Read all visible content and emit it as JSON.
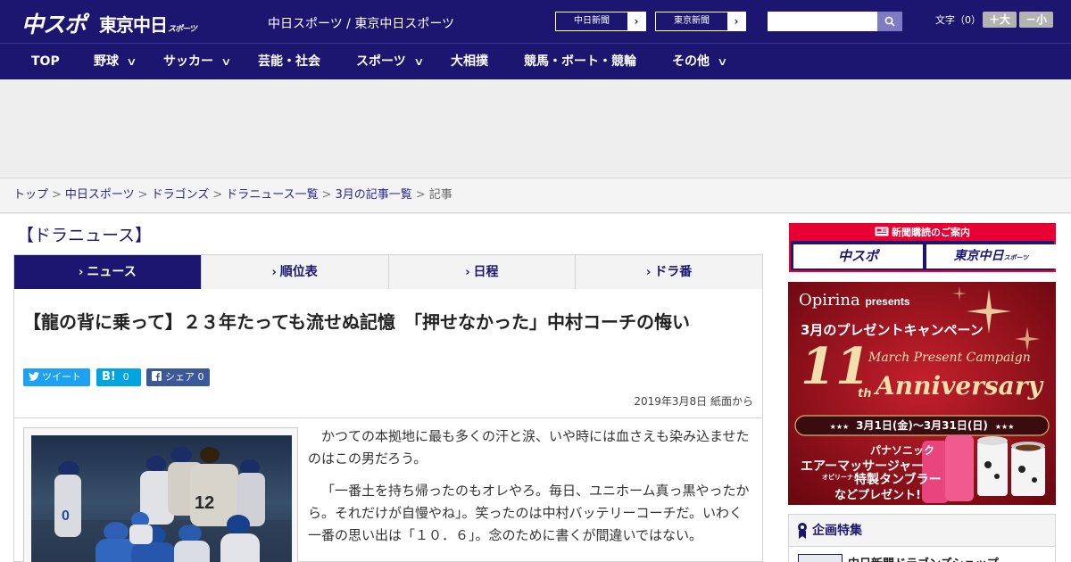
{
  "header": {
    "logo_main": "中スポ",
    "logo_sub": "東京中日",
    "logo_sub_small": "スポーツ",
    "site_title": "中日スポーツ / 東京中日スポーツ",
    "paper_links": [
      {
        "label": "中日新聞",
        "arrow": "›"
      },
      {
        "label": "東京新聞",
        "arrow": "›"
      }
    ],
    "search_placeholder": "",
    "fontsize_label": "文字（0）",
    "fontsize_up": "＋大",
    "fontsize_down": "－小"
  },
  "nav": [
    {
      "label": "TOP",
      "dropdown": false
    },
    {
      "label": "野球",
      "dropdown": true
    },
    {
      "label": "サッカー",
      "dropdown": true
    },
    {
      "label": "芸能・社会",
      "dropdown": false
    },
    {
      "label": "スポーツ",
      "dropdown": true
    },
    {
      "label": "大相撲",
      "dropdown": false
    },
    {
      "label": "競馬・ボート・競輪",
      "dropdown": false
    },
    {
      "label": "その他",
      "dropdown": true
    }
  ],
  "nav_chevron": "∨",
  "breadcrumb": {
    "links": [
      "トップ",
      "中日スポーツ",
      "ドラゴンズ",
      "ドラニュース一覧",
      "3月の記事一覧"
    ],
    "separator": ">",
    "current": "記事"
  },
  "section_title": "【ドラニュース】",
  "tabs": [
    {
      "label": "ニュース",
      "active": true
    },
    {
      "label": "順位表",
      "active": false
    },
    {
      "label": "日程",
      "active": false
    },
    {
      "label": "ドラ番",
      "active": false
    }
  ],
  "tab_chevron": "›",
  "article": {
    "headline": "【龍の背に乗って】２３年たっても流せぬ記憶　「押せなかった」中村コーチの悔い",
    "share": {
      "tweet": "ツイート",
      "hatena": "B!",
      "hatena_count": "0",
      "facebook": "シェア",
      "facebook_count": "0"
    },
    "dateline": "2019年3月8日 紙面から",
    "paragraphs": [
      "かつての本拠地に最も多くの汗と涙、いや時には血さえも染み込ませたのはこの男だろう。",
      "「一番土を持ち帰ったのもオレやろ。毎日、ユニホーム真っ黒やったから。それだけが自慢やね」。笑ったのは中村バッテリーコーチだ。いわく一番の思い出は「１０．６」。念のために書くが間違いではない。"
    ],
    "photo_jersey": "12"
  },
  "sidebar": {
    "subscribe_title": "新聞購読のご案内",
    "subscribe_buttons": [
      "中スポ",
      "東京中日"
    ],
    "subscribe_small": "スポーツ",
    "promo": {
      "brand": "Opirina",
      "presents": "presents",
      "title": "3月のプレゼントキャンペーン",
      "number": "11",
      "suffix": "th",
      "campaign": "March Present Campaign",
      "anniversary": "Anniversary",
      "period": "3月1日(金)〜3月31日(日)",
      "stars": "★★★",
      "prize_1": "パナソニック",
      "prize_2": "エアーマッサージャー",
      "prize_3": "オピリーナ",
      "prize_4": "特製タンブラー",
      "prize_5": "などプレゼント!"
    },
    "feature_title": "企画特集",
    "feature_item": "中日新聞ドラゴンズショップ"
  },
  "colors": {
    "navy": "#1c1670",
    "red": "#e60033",
    "twitter": "#1da1f2",
    "hatena": "#00a4de",
    "facebook": "#3b5998"
  }
}
